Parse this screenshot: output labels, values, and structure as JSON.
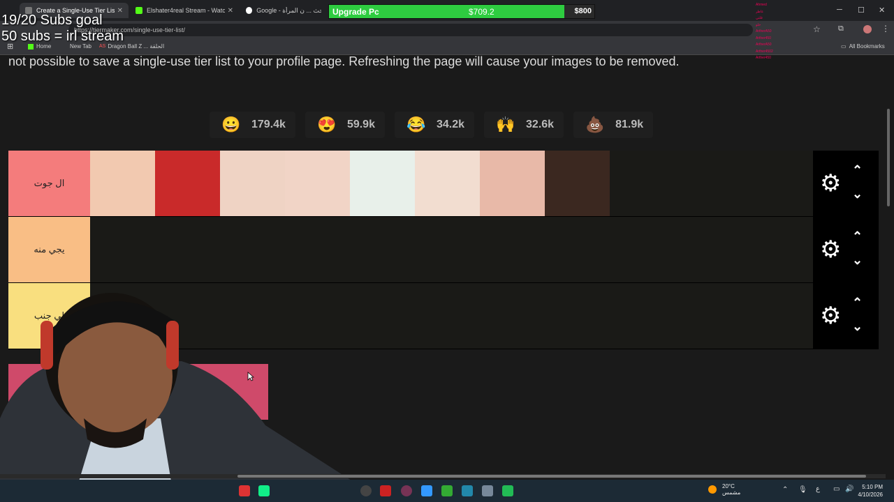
{
  "browser": {
    "tabs": [
      {
        "label": "Create a Single-Use Tier List (P...",
        "color": "#555"
      },
      {
        "label": "Elshater4real Stream - Watch Li...",
        "color": "#53fc18"
      },
      {
        "label": "Google - بحث ... ن المرأة",
        "color": "#4285f4"
      }
    ],
    "url": "https://tiermaker.com/single-use-tier-list/",
    "bookmarks": [
      "Home",
      "New Tab",
      "Dragon Ball Z ... الحلقة"
    ],
    "all_bookmarks": "All Bookmarks"
  },
  "overlay": {
    "goal_line1": "19/20 Subs goal",
    "goal_line2": "50 subs = irl stream",
    "upgrade_label": "Upgrade Pc",
    "upgrade_current": "$709.2",
    "upgrade_max": "$800",
    "upgrade_progress": 0.887,
    "chat": [
      "Ahmed",
      "عاطر",
      "قلتي",
      "خلو",
      "ArtherA50",
      "Arther450",
      "ArtherA50",
      "Arther4502",
      "Arther450"
    ]
  },
  "page": {
    "notice": "not possible to save a single-use tier list to your profile page. Refreshing the page will cause your images to be removed.",
    "reactions": [
      {
        "icon": "grinning-face-icon",
        "glyph": "😀",
        "count": "179.4k"
      },
      {
        "icon": "heart-eyes-icon",
        "glyph": "😍",
        "count": "59.9k"
      },
      {
        "icon": "laughing-face-icon",
        "glyph": "😂",
        "count": "34.2k"
      },
      {
        "icon": "raised-hands-icon",
        "glyph": "🙌",
        "count": "32.6k"
      },
      {
        "icon": "poop-icon",
        "glyph": "💩",
        "count": "81.9k"
      }
    ],
    "tiers": [
      {
        "label": "ال جوت",
        "color": "#f47c7c",
        "items": [
          {
            "name": "cartoon-leg",
            "color": "#f2c9b0"
          },
          {
            "name": "red-suit-figure",
            "color": "#c92a2a"
          },
          {
            "name": "shoulder",
            "color": "#efd3c4"
          },
          {
            "name": "hand",
            "color": "#f1d4c6"
          },
          {
            "name": "cartoon-figure",
            "color": "#e8f0ea"
          },
          {
            "name": "face",
            "color": "#f2ddd0"
          },
          {
            "name": "nose",
            "color": "#e8b9a8"
          },
          {
            "name": "woman-portrait",
            "color": "#3b2820"
          }
        ]
      },
      {
        "label": "يجي منه",
        "color": "#f9be85",
        "items": []
      },
      {
        "label": "لي جنب",
        "color": "#f9df7f",
        "items": []
      }
    ]
  },
  "taskbar": {
    "temperature": "20°C",
    "weather_text": "مشمس",
    "time": "5:10 PM",
    "date": "4/10/2026"
  }
}
